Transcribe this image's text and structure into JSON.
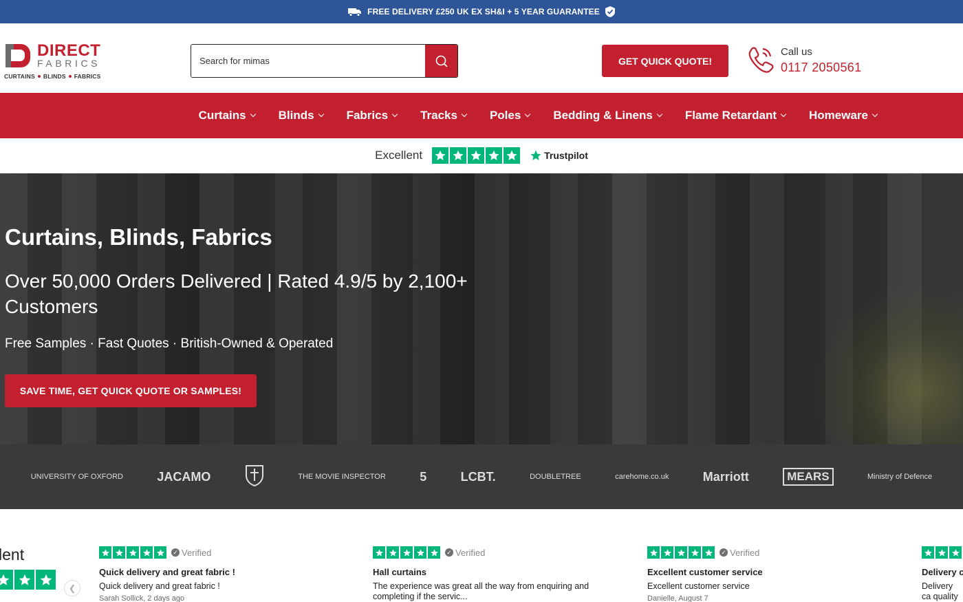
{
  "topbar": {
    "text": "FREE DELIVERY £250 UK EX SH&I + 5 YEAR GUARANTEE"
  },
  "logo": {
    "name1": "DIRECT",
    "name2": "FABRICS",
    "tag1": "CURTAINS",
    "tag2": "BLINDS",
    "tag3": "FABRICS"
  },
  "search": {
    "placeholder": "Search for mimas"
  },
  "header": {
    "quote_label": "GET QUICK QUOTE!",
    "call_label": "Call us",
    "phone": "0117 2050561"
  },
  "nav": {
    "items": [
      "Curtains",
      "Blinds",
      "Fabrics",
      "Tracks",
      "Poles",
      "Bedding & Linens",
      "Flame Retardant",
      "Homeware"
    ]
  },
  "trust": {
    "label": "Excellent",
    "brand": "Trustpilot"
  },
  "hero": {
    "title": "Curtains, Blinds, Fabrics",
    "headline": "Over 50,000 Orders Delivered | Rated 4.9/5 by 2,100+ Customers",
    "sub": "Free Samples · Fast Quotes · British-Owned & Operated",
    "cta": "SAVE TIME, GET QUICK QUOTE OR SAMPLES!"
  },
  "clients": [
    "UNIVERSITY OF OXFORD",
    "JACAMO",
    "THE MOVIE INSPECTOR",
    "5",
    "LCBT.",
    "DOUBLETREE",
    "carehome.co.uk",
    "Marriott",
    "MEARS",
    "Ministry of Defence"
  ],
  "reviews": {
    "summary_label": "lent",
    "verified": "Verified",
    "items": [
      {
        "title": "Quick delivery and great fabric !",
        "body": "Quick delivery and great fabric !",
        "author": "Sarah Sollick, 2 days ago"
      },
      {
        "title": "Hall curtains",
        "body": "The experience was great all the way from enquiring and completing if the servic...",
        "author": ""
      },
      {
        "title": "Excellent customer service",
        "body": "Excellent customer service",
        "author": "Danielle, August 7"
      },
      {
        "title": "Delivery c",
        "body": "Delivery ca quality curt",
        "author": ""
      }
    ]
  },
  "colors": {
    "brand_red": "#c3202f",
    "topbar_blue": "#2d5597",
    "trustpilot_green": "#00b67a"
  }
}
